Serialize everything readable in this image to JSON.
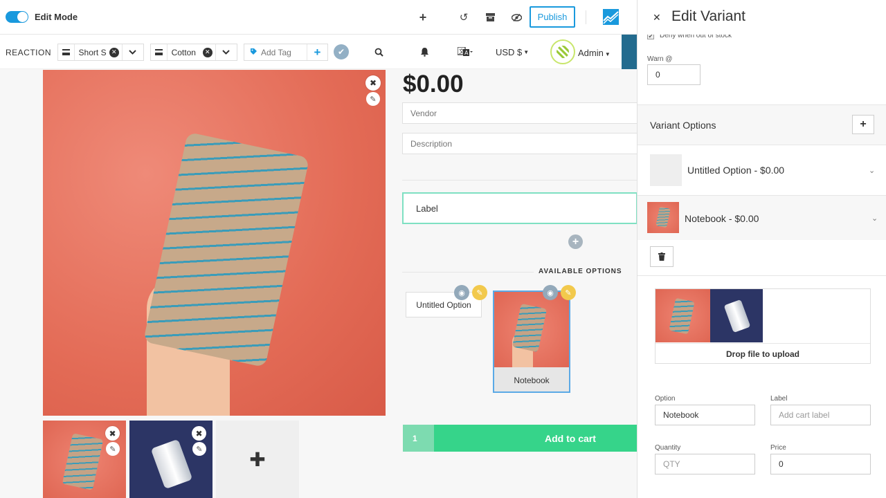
{
  "topbar": {
    "edit_mode_label": "Edit Mode",
    "publish_label": "Publish",
    "icons": [
      "plus-icon",
      "undo-icon",
      "archive-icon",
      "eye-slash-icon"
    ]
  },
  "subbar": {
    "brand": "REACTION",
    "chip1_text": "Short Sl",
    "chip2_text": "Cotton",
    "tag_placeholder": "Add Tag",
    "currency": "USD $",
    "admin": "Admin"
  },
  "product": {
    "price": "$0.00",
    "vendor_placeholder": "Vendor",
    "description_placeholder": "Description",
    "label_value": "Label",
    "available_options_title": "AVAILABLE OPTIONS",
    "option1_label": "Untitled Option",
    "option2_label": "Notebook",
    "quantity": "1",
    "add_to_cart": "Add to cart"
  },
  "panel": {
    "title": "Edit Variant",
    "deny_label": "Deny when out of stock",
    "warn_label": "Warn @",
    "warn_value": "0",
    "variant_options_title": "Variant Options",
    "options": [
      {
        "label": "Untitled Option - $0.00"
      },
      {
        "label": "Notebook - $0.00"
      }
    ],
    "drop_text": "Drop file to upload",
    "option_label": "Option",
    "option_value": "Notebook",
    "label_label": "Label",
    "label_placeholder": "Add cart label",
    "quantity_label": "Quantity",
    "quantity_placeholder": "QTY",
    "price_label": "Price",
    "price_value": "0"
  },
  "colors": {
    "accent": "#1999dd",
    "cart_green": "#36d48a",
    "label_border": "#7ee0c2"
  }
}
